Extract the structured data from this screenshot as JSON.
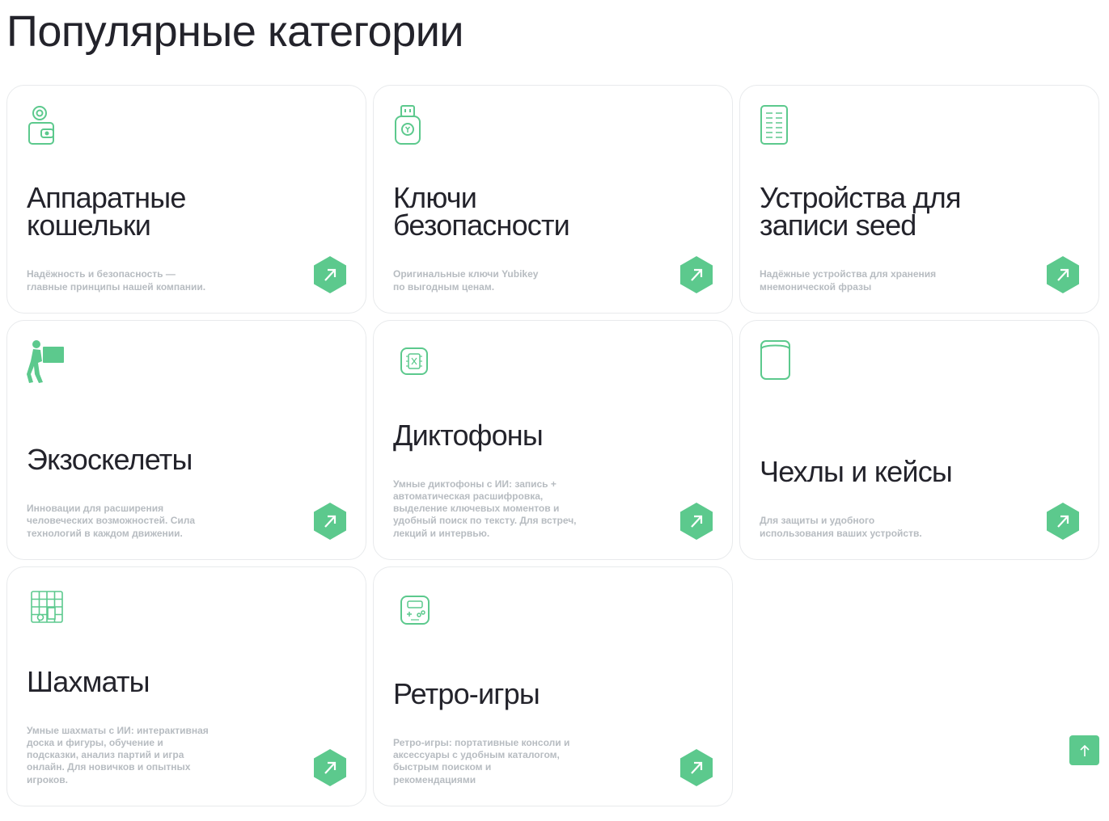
{
  "page": {
    "title": "Популярные категории"
  },
  "colors": {
    "accent": "#5cc98d",
    "title": "#23232b",
    "muted": "#b7bcc1",
    "border": "#e8eaec"
  },
  "cards": [
    {
      "title": "Аппаратные\nкошельки",
      "desc": "Надёжность и безопасность —\nглавные принципы нашей компании.",
      "icon": "wallet-icon"
    },
    {
      "title": "Ключи\nбезопасности",
      "desc": "Оригинальные ключи Yubikey\nпо выгодным ценам.",
      "icon": "usb-key-icon"
    },
    {
      "title": "Устройства для\nзаписи seed",
      "desc": "Надёжные устройства для хранения\nмнемонической фразы",
      "icon": "seed-plate-icon"
    },
    {
      "title": "Экзоскелеты",
      "desc": "Инновации для расширения\nчеловеческих возможностей. Сила\nтехнологий в каждом движении.",
      "icon": "exoskeleton-icon"
    },
    {
      "title": "Диктофоны",
      "desc": "Умные диктофоны с ИИ: запись +\nавтоматическая расшифровка,\nвыделение ключевых моментов и\nудобный поиск по тексту. Для встреч,\nлекций и интервью.",
      "icon": "recorder-chip-icon"
    },
    {
      "title": "Чехлы и кейсы",
      "desc": "Для защиты и удобного\nиспользования ваших устройств.",
      "icon": "case-icon"
    },
    {
      "title": "Шахматы",
      "desc": "Умные шахматы с ИИ: интерактивная\nдоска и фигуры, обучение и\nподсказки, анализ партий и игра\nонлайн. Для новичков и опытных\nигроков.",
      "icon": "chess-board-icon"
    },
    {
      "title": "Ретро-игры",
      "desc": "Ретро-игры: портативные консоли и\nаксессуары с удобным каталогом,\nбыстрым поиском и\nрекомендациями",
      "icon": "retro-console-icon"
    }
  ],
  "scroll_top": {
    "icon": "arrow-up-icon"
  }
}
